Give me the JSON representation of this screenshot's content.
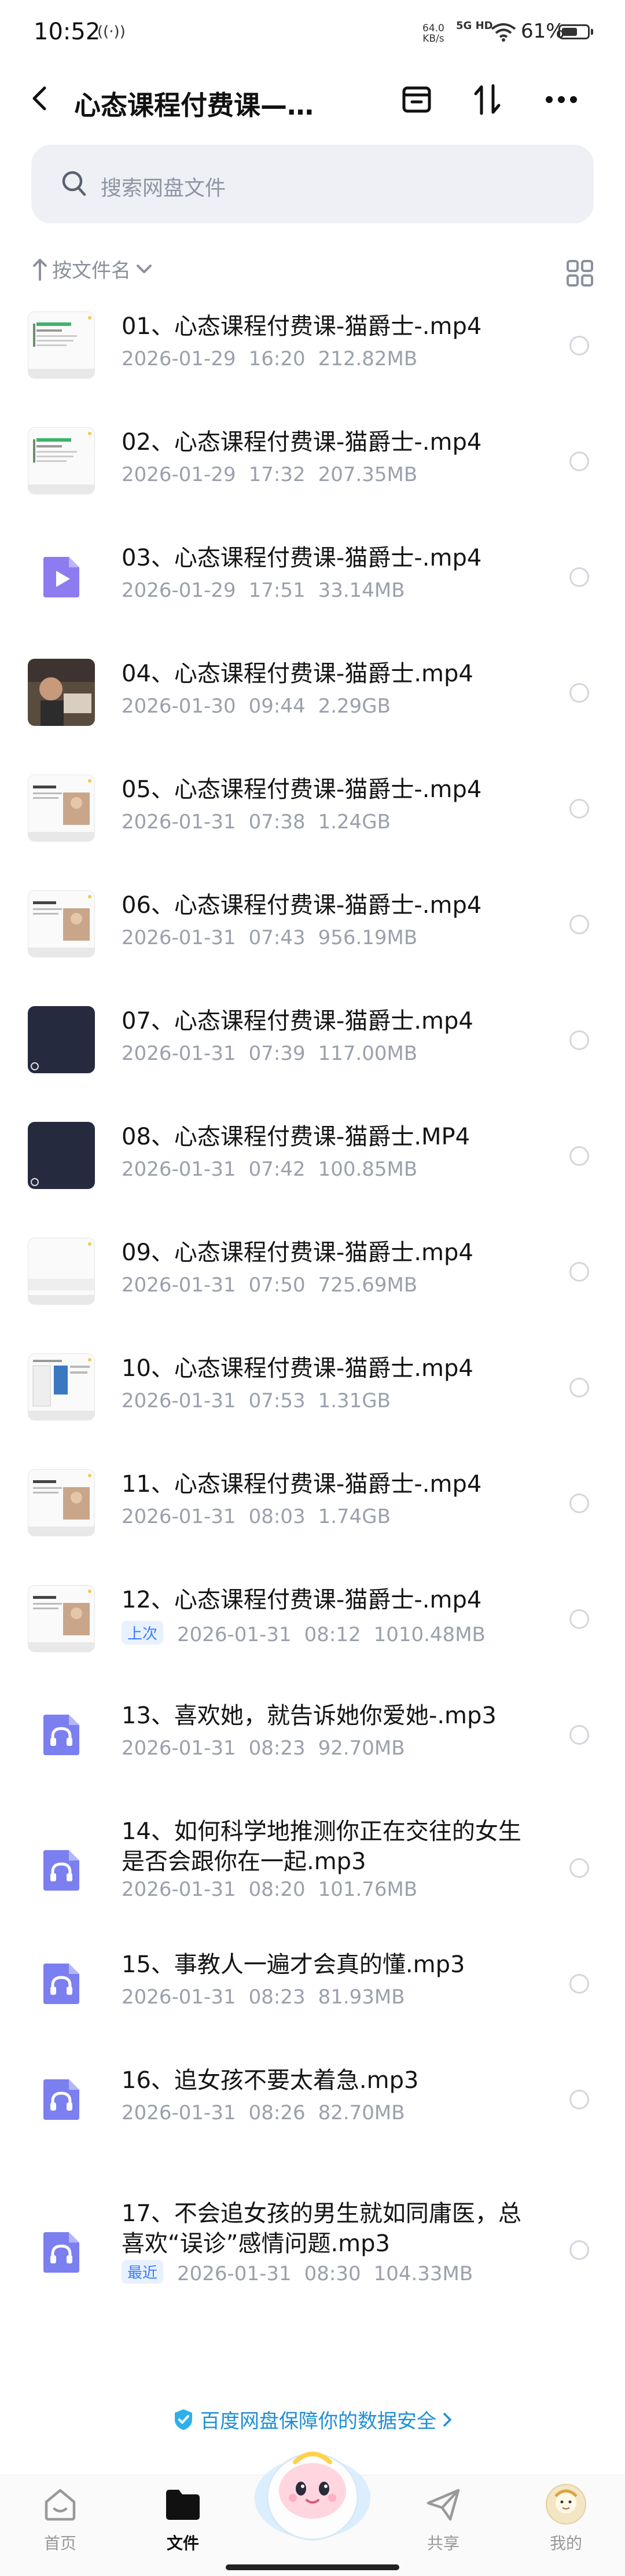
{
  "status": {
    "time": "10:52",
    "net_speed": "64.0",
    "net_unit": "KB/s",
    "network": "5G HD",
    "battery": "61%",
    "battery_level": 0.61
  },
  "header": {
    "title": "心态课程付费课—…"
  },
  "search": {
    "placeholder": "搜索网盘文件"
  },
  "sort": {
    "label": "按文件名"
  },
  "files": [
    {
      "name": "01、心态课程付费课-猫爵士-.mp4",
      "date": "2026-01-29",
      "time": "16:20",
      "size": "212.82MB",
      "thumb": "doc-green"
    },
    {
      "name": "02、心态课程付费课-猫爵士-.mp4",
      "date": "2026-01-29",
      "time": "17:32",
      "size": "207.35MB",
      "thumb": "doc-green"
    },
    {
      "name": "03、心态课程付费课-猫爵士-.mp4",
      "date": "2026-01-29",
      "time": "17:51",
      "size": "33.14MB",
      "thumb": "video-icon"
    },
    {
      "name": "04、心态课程付费课-猫爵士.mp4",
      "date": "2026-01-30",
      "time": "09:44",
      "size": "2.29GB",
      "thumb": "photo"
    },
    {
      "name": "05、心态课程付费课-猫爵士-.mp4",
      "date": "2026-01-31",
      "time": "07:38",
      "size": "1.24GB",
      "thumb": "doc-photo"
    },
    {
      "name": "06、心态课程付费课-猫爵士-.mp4",
      "date": "2026-01-31",
      "time": "07:43",
      "size": "956.19MB",
      "thumb": "doc-photo"
    },
    {
      "name": "07、心态课程付费课-猫爵士.mp4",
      "date": "2026-01-31",
      "time": "07:39",
      "size": "117.00MB",
      "thumb": "dark"
    },
    {
      "name": "08、心态课程付费课-猫爵士.MP4",
      "date": "2026-01-31",
      "time": "07:42",
      "size": "100.85MB",
      "thumb": "dark"
    },
    {
      "name": "09、心态课程付费课-猫爵士.mp4",
      "date": "2026-01-31",
      "time": "07:50",
      "size": "725.69MB",
      "thumb": "doc-blank"
    },
    {
      "name": "10、心态课程付费课-猫爵士.mp4",
      "date": "2026-01-31",
      "time": "07:53",
      "size": "1.31GB",
      "thumb": "doc-blue"
    },
    {
      "name": "11、心态课程付费课-猫爵士-.mp4",
      "date": "2026-01-31",
      "time": "08:03",
      "size": "1.74GB",
      "thumb": "doc-photo"
    },
    {
      "name": "12、心态课程付费课-猫爵士-.mp4",
      "date": "2026-01-31",
      "time": "08:12",
      "size": "1010.48MB",
      "thumb": "doc-photo",
      "tag": "上次"
    },
    {
      "name": "13、喜欢她，就告诉她你爱她-.mp3",
      "date": "2026-01-31",
      "time": "08:23",
      "size": "92.70MB",
      "thumb": "audio"
    },
    {
      "name": "14、如何科学地推测你正在交往的女生是否会跟你在一起.mp3",
      "date": "2026-01-31",
      "time": "08:20",
      "size": "101.76MB",
      "thumb": "audio"
    },
    {
      "name": "15、事教人一遍才会真的懂.mp3",
      "date": "2026-01-31",
      "time": "08:23",
      "size": "81.93MB",
      "thumb": "audio"
    },
    {
      "name": "16、追女孩不要太着急.mp3",
      "date": "2026-01-31",
      "time": "08:26",
      "size": "82.70MB",
      "thumb": "audio"
    },
    {
      "name": "17、不会追女孩的男生就如同庸医，总喜欢“误诊”感情问题.mp3",
      "date": "2026-01-31",
      "time": "08:30",
      "size": "104.33MB",
      "thumb": "audio",
      "tag": "最近"
    }
  ],
  "footer": {
    "safety": "百度网盘保障你的数据安全"
  },
  "tabs": [
    {
      "label": "首页",
      "icon": "home-icon"
    },
    {
      "label": "文件",
      "icon": "folder-icon",
      "active": true
    },
    {
      "label": "共享",
      "icon": "share-icon"
    },
    {
      "label": "我的",
      "icon": "avatar"
    }
  ],
  "colors": {
    "accent": "#3a7bff",
    "audio_icon": "#7b7ff0",
    "video_icon": "#8d7bf0",
    "safety_text": "#1e8fd6"
  }
}
